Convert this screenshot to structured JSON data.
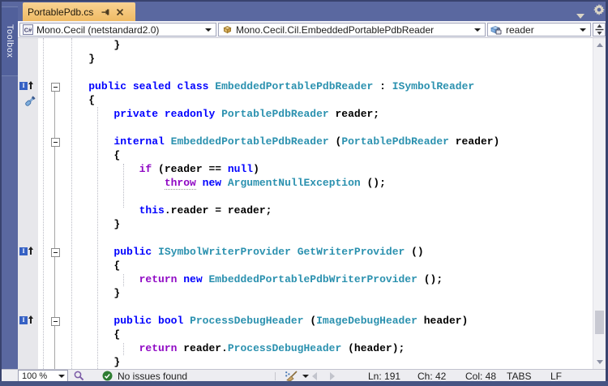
{
  "tab": {
    "title": "PortablePdb.cs"
  },
  "toolbox_label": "Toolbox",
  "navbar": {
    "project": "Mono.Cecil (netstandard2.0)",
    "type_name": "Mono.Cecil.Cil.EmbeddedPortablePdbReader",
    "member": "reader"
  },
  "status": {
    "zoom_level": "100 %",
    "health": "No issues found",
    "line": "Ln: 191",
    "character": "Ch: 42",
    "column": "Col: 48",
    "indent_mode": "TABS",
    "line_ending": "LF"
  },
  "icons": {
    "tab_pin": "pin-icon",
    "tab_close": "close-icon",
    "window_chevron": "chevron-down-icon",
    "window_gear": "gear-icon",
    "project_icon": "csharp-project-icon",
    "type_icon": "class-icon",
    "member_icon": "private-field-icon",
    "split_editor": "split-window-icon",
    "implements_glyph": "implements-arrow-icon",
    "quick_action": "screwdriver-icon",
    "health_check": "check-circle-icon",
    "analysis": "magnifier-icon",
    "code_cleanup": "broom-icon"
  },
  "colors": {
    "keyword": "#0000FF",
    "control_keyword": "#8F08C4",
    "type": "#2B91AF",
    "method": "#2B91AF",
    "plain": "#000000",
    "active_tab": "#EFBA64",
    "chrome_blue": "#5A68A0",
    "health_green": "#2E7D32",
    "analysis_purple": "#7B5AA6"
  },
  "editor": {
    "lines": [
      [
        [
          "p",
          "        }"
        ]
      ],
      [
        [
          "p",
          "    }"
        ]
      ],
      [],
      [
        [
          "p",
          "    "
        ],
        [
          "k",
          "public"
        ],
        [
          "p",
          " "
        ],
        [
          "k",
          "sealed"
        ],
        [
          "p",
          " "
        ],
        [
          "k",
          "class"
        ],
        [
          "p",
          " "
        ],
        [
          "t",
          "EmbeddedPortablePdbReader"
        ],
        [
          "p",
          " : "
        ],
        [
          "t",
          "ISymbolReader"
        ]
      ],
      [
        [
          "p",
          "    {"
        ]
      ],
      [
        [
          "p",
          "        "
        ],
        [
          "k",
          "private"
        ],
        [
          "p",
          " "
        ],
        [
          "k",
          "readonly"
        ],
        [
          "p",
          " "
        ],
        [
          "t",
          "PortablePdbReader"
        ],
        [
          "p",
          " reader;"
        ]
      ],
      [],
      [
        [
          "p",
          "        "
        ],
        [
          "k",
          "internal"
        ],
        [
          "p",
          " "
        ],
        [
          "t",
          "EmbeddedPortablePdbReader"
        ],
        [
          "p",
          " ("
        ],
        [
          "t",
          "PortablePdbReader"
        ],
        [
          "p",
          " reader)"
        ]
      ],
      [
        [
          "p",
          "        {"
        ]
      ],
      [
        [
          "p",
          "            "
        ],
        [
          "c",
          "if"
        ],
        [
          "p",
          " (reader == "
        ],
        [
          "k",
          "null"
        ],
        [
          "p",
          ")"
        ]
      ],
      [
        [
          "p",
          "                "
        ],
        [
          "cu",
          "throw"
        ],
        [
          "p",
          " "
        ],
        [
          "k",
          "new"
        ],
        [
          "p",
          " "
        ],
        [
          "t",
          "ArgumentNullException"
        ],
        [
          "p",
          " ();"
        ]
      ],
      [],
      [
        [
          "p",
          "            "
        ],
        [
          "k",
          "this"
        ],
        [
          "p",
          ".reader = reader;"
        ]
      ],
      [
        [
          "p",
          "        }"
        ]
      ],
      [],
      [
        [
          "p",
          "        "
        ],
        [
          "k",
          "public"
        ],
        [
          "p",
          " "
        ],
        [
          "t",
          "ISymbolWriterProvider"
        ],
        [
          "p",
          " "
        ],
        [
          "m",
          "GetWriterProvider"
        ],
        [
          "p",
          " ()"
        ]
      ],
      [
        [
          "p",
          "        {"
        ]
      ],
      [
        [
          "p",
          "            "
        ],
        [
          "c",
          "return"
        ],
        [
          "p",
          " "
        ],
        [
          "k",
          "new"
        ],
        [
          "p",
          " "
        ],
        [
          "t",
          "EmbeddedPortablePdbWriterProvider"
        ],
        [
          "p",
          " ();"
        ]
      ],
      [
        [
          "p",
          "        }"
        ]
      ],
      [],
      [
        [
          "p",
          "        "
        ],
        [
          "k",
          "public"
        ],
        [
          "p",
          " "
        ],
        [
          "k",
          "bool"
        ],
        [
          "p",
          " "
        ],
        [
          "m",
          "ProcessDebugHeader"
        ],
        [
          "p",
          " ("
        ],
        [
          "t",
          "ImageDebugHeader"
        ],
        [
          "p",
          " header)"
        ]
      ],
      [
        [
          "p",
          "        {"
        ]
      ],
      [
        [
          "p",
          "            "
        ],
        [
          "c",
          "return"
        ],
        [
          "p",
          " reader."
        ],
        [
          "m",
          "ProcessDebugHeader"
        ],
        [
          "p",
          " (header);"
        ]
      ],
      [
        [
          "p",
          "        }"
        ]
      ]
    ]
  }
}
